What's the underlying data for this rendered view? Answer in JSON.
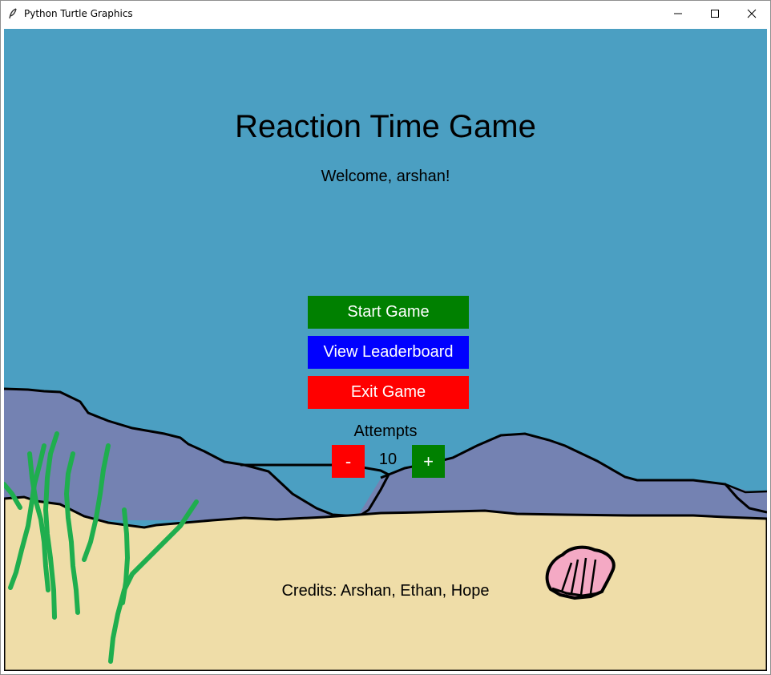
{
  "window": {
    "title": "Python Turtle Graphics",
    "controls": {
      "minimize": "—",
      "maximize": "☐",
      "close": "✕"
    }
  },
  "game": {
    "title": "Reaction Time Game",
    "welcome": "Welcome, arshan!",
    "buttons": {
      "start": "Start Game",
      "leaderboard": "View Leaderboard",
      "exit": "Exit Game"
    },
    "attempts": {
      "label": "Attempts",
      "decrement": "-",
      "value": "10",
      "increment": "+"
    },
    "credits": "Credits: Arshan, Ethan, Hope"
  },
  "colors": {
    "water": "#4b9fc2",
    "hills": "#7482b2",
    "sand": "#efdda8",
    "seaweed": "#1fae4e",
    "start_button": "#008000",
    "leaderboard_button": "#0000ff",
    "exit_button": "#ff0000",
    "decrement_button": "#ff0000",
    "increment_button": "#008000",
    "shell": "#f4a9c4"
  },
  "icons": {
    "app": "feather-icon",
    "shell": "seashell-icon"
  }
}
